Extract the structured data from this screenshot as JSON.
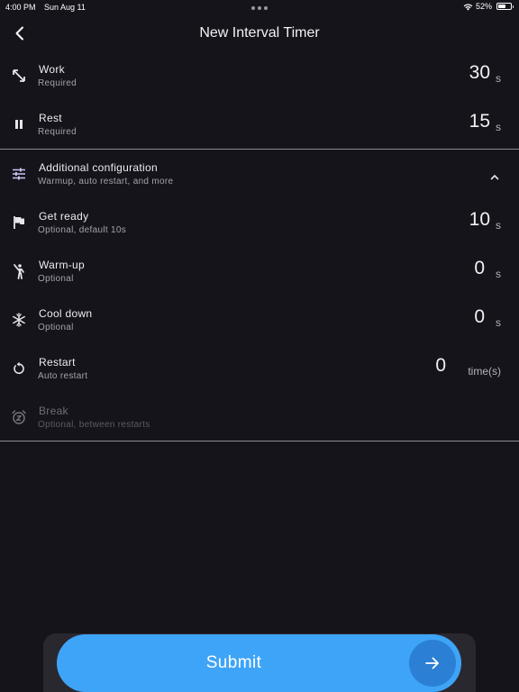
{
  "status_bar": {
    "time": "4:00 PM",
    "date": "Sun Aug 11",
    "battery": "52%"
  },
  "nav": {
    "title": "New Interval Timer"
  },
  "rows": {
    "work": {
      "title": "Work",
      "subtitle": "Required",
      "value": "30",
      "unit": "s",
      "icon": "expand-arrows-icon"
    },
    "rest": {
      "title": "Rest",
      "subtitle": "Required",
      "value": "15",
      "unit": "s",
      "icon": "pause-icon"
    },
    "additional": {
      "title": "Additional configuration",
      "subtitle": "Warmup, auto restart, and more",
      "icon": "sliders-icon",
      "expanded": true
    },
    "get_ready": {
      "title": "Get ready",
      "subtitle": "Optional, default 10s",
      "value": "10",
      "unit": "s",
      "icon": "flag-icon"
    },
    "warm_up": {
      "title": "Warm-up",
      "subtitle": "Optional",
      "value": "0",
      "unit": "s",
      "icon": "person-stretching-icon"
    },
    "cool_down": {
      "title": "Cool down",
      "subtitle": "Optional",
      "value": "0",
      "unit": "s",
      "icon": "snowflake-icon"
    },
    "restart": {
      "title": "Restart",
      "subtitle": "Auto restart",
      "value": "0",
      "unit": "time(s)",
      "icon": "restart-icon"
    },
    "break": {
      "title": "Break",
      "subtitle": "Optional, between restarts",
      "icon": "snooze-alarm-icon",
      "disabled": true
    }
  },
  "submit": {
    "label": "Submit",
    "icon": "arrow-right-icon"
  },
  "colors": {
    "background": "#16141b",
    "accent": "#3ea4f7",
    "accent_dark": "#2b7fd4"
  }
}
